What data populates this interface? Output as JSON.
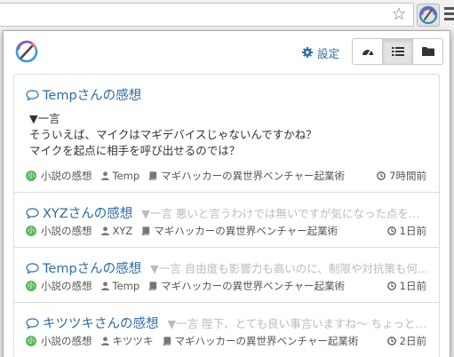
{
  "popup": {
    "settings_label": "設定",
    "view_buttons": [
      "dashboard-icon",
      "list-icon",
      "folder-icon"
    ],
    "active_view": "list-icon"
  },
  "colors": {
    "link": "#2e6da4",
    "badge": "#5cb85c",
    "excerpt": "#bbbbbb"
  },
  "items": [
    {
      "title": "Tempさんの感想",
      "body": [
        "▼一言",
        "そういえば、マイクはマギデバイスじゃないんですかね？",
        "マイクを起点に相手を呼び出せるのでは？"
      ],
      "category_badge": "小",
      "category": "小説の感想",
      "user": "Temp",
      "book": "マギハッカーの異世界ベンチャー起業術",
      "time": "7時間前"
    },
    {
      "title": "XYZさんの感想",
      "excerpt": "▼一言 悪いと言うわけでは無いですが気になった点を。…",
      "category_badge": "小",
      "category": "小説の感想",
      "user": "XYZ",
      "book": "マギハッカーの異世界ベンチャー起業術",
      "time": "1日前"
    },
    {
      "title": "Tempさんの感想",
      "excerpt": "▼一言 自由度も影響力も高いのに、制限や対抗策も何も…",
      "category_badge": "小",
      "category": "小説の感想",
      "user": "Temp",
      "book": "マギハッカーの異世界ベンチャー起業術",
      "time": "1日前"
    },
    {
      "title": "キツツキさんの感想",
      "excerpt": "▼一言 陛下、とても良い事言いますね〜 ちょっと王…",
      "category_badge": "小",
      "category": "小説の感想",
      "user": "キツツキ",
      "book": "マギハッカーの異世界ベンチャー起業術",
      "time": "2日前"
    }
  ]
}
